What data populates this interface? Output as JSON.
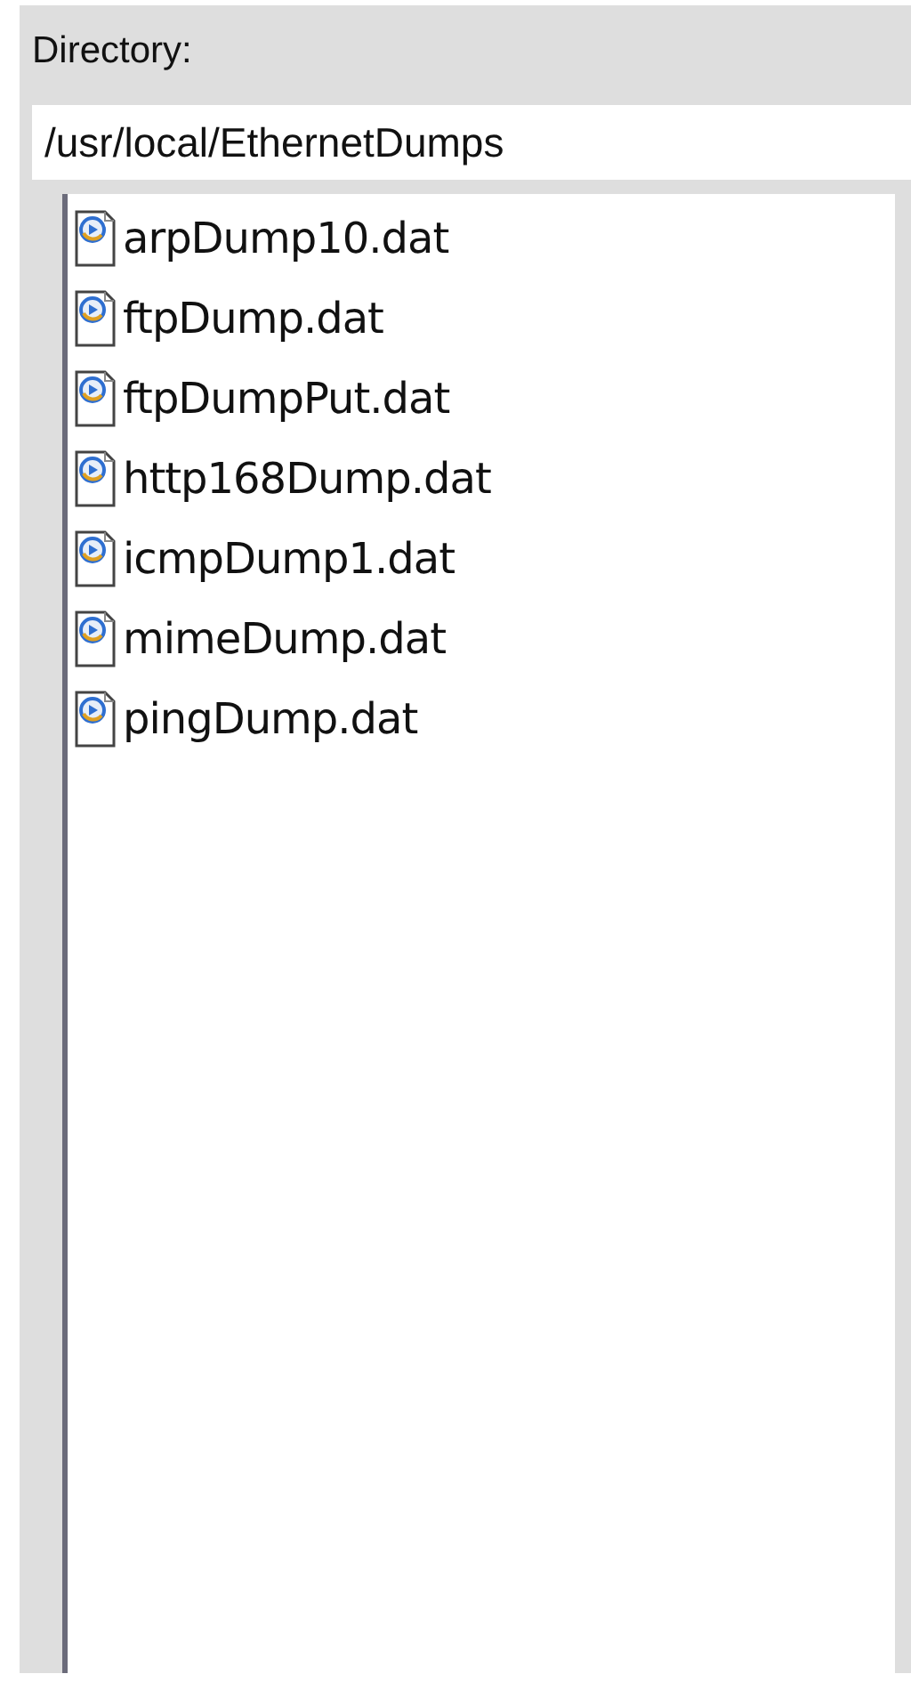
{
  "directory": {
    "label": "Directory:",
    "path": "/usr/local/EthernetDumps"
  },
  "files": [
    {
      "name": "arpDump10.dat"
    },
    {
      "name": "ftpDump.dat"
    },
    {
      "name": "ftpDumpPut.dat"
    },
    {
      "name": "http168Dump.dat"
    },
    {
      "name": "icmpDump1.dat"
    },
    {
      "name": "mimeDump.dat"
    },
    {
      "name": "pingDump.dat"
    }
  ]
}
